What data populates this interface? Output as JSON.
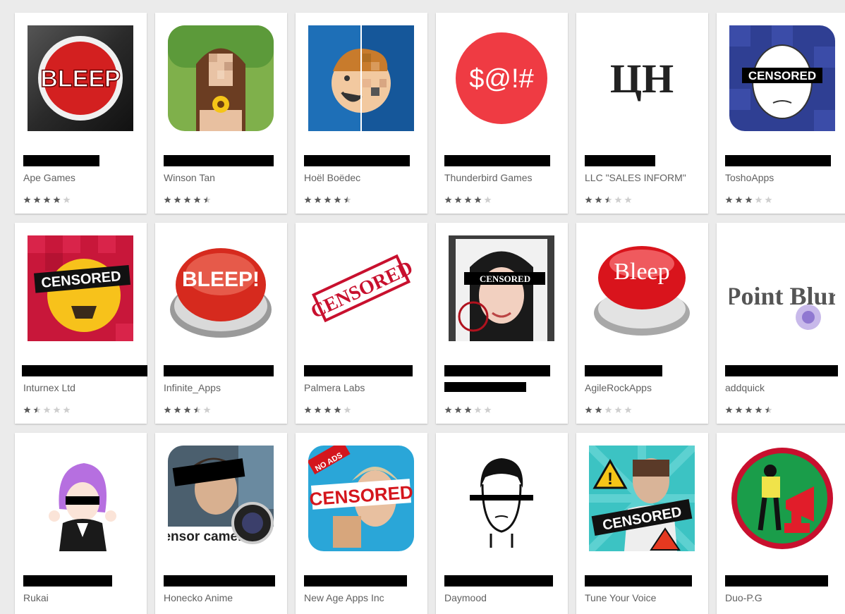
{
  "colors": {
    "background": "#ebebeb",
    "card": "#ffffff",
    "star_filled": "#5b5b5b",
    "star_empty": "#cfcfcf",
    "developer_text": "#616161"
  },
  "cards": [
    {
      "developer": "Ape Games",
      "rating": 4,
      "redact_width": 108,
      "icon_text": "BLEEP"
    },
    {
      "developer": "Winson Tan",
      "rating": 4.5,
      "redact_width": 156,
      "icon_text": ""
    },
    {
      "developer": "Hoël Boëdec",
      "rating": 4.5,
      "redact_width": 150,
      "icon_text": ""
    },
    {
      "developer": "Thunderbird Games",
      "rating": 4,
      "redact_width": 150,
      "icon_text": "$@!#"
    },
    {
      "developer": "LLC \"SALES INFORM\"",
      "rating": 2.5,
      "redact_width": 100,
      "icon_text": "ЦН"
    },
    {
      "developer": "ToshoApps",
      "rating": 3,
      "redact_width": 150,
      "icon_text": "CENSORED"
    },
    {
      "developer": "Inturnex Ltd",
      "rating": 1.5,
      "redact_width": 178,
      "icon_text": "CENSORED"
    },
    {
      "developer": "Infinite_Apps",
      "rating": 3.5,
      "redact_width": 156,
      "icon_text": "BLEEP!"
    },
    {
      "developer": "Palmera Labs",
      "rating": 4,
      "redact_width": 154,
      "icon_text": "CENSORED"
    },
    {
      "developer": "",
      "rating": 3,
      "redact_width": 150,
      "icon_text": "CENSORED"
    },
    {
      "developer": "AgileRockApps",
      "rating": 2,
      "redact_width": 110,
      "icon_text": "Bleep"
    },
    {
      "developer": "addquick",
      "rating": 4.5,
      "redact_width": 160,
      "icon_text": "Point Blur"
    },
    {
      "developer": "Rukai",
      "rating": null,
      "redact_width": 126,
      "icon_text": ""
    },
    {
      "developer": "Honecko Anime",
      "rating": null,
      "redact_width": 158,
      "icon_text": "censor camera"
    },
    {
      "developer": "New Age Apps Inc",
      "rating": null,
      "redact_width": 146,
      "icon_text": "CENSORED",
      "badge": "NO ADS"
    },
    {
      "developer": "Daymood",
      "rating": null,
      "redact_width": 154,
      "icon_text": ""
    },
    {
      "developer": "Tune Your Voice",
      "rating": null,
      "redact_width": 152,
      "icon_text": "CENSORED"
    },
    {
      "developer": "Duo-P.G",
      "rating": null,
      "redact_width": 146,
      "icon_text": ""
    }
  ]
}
